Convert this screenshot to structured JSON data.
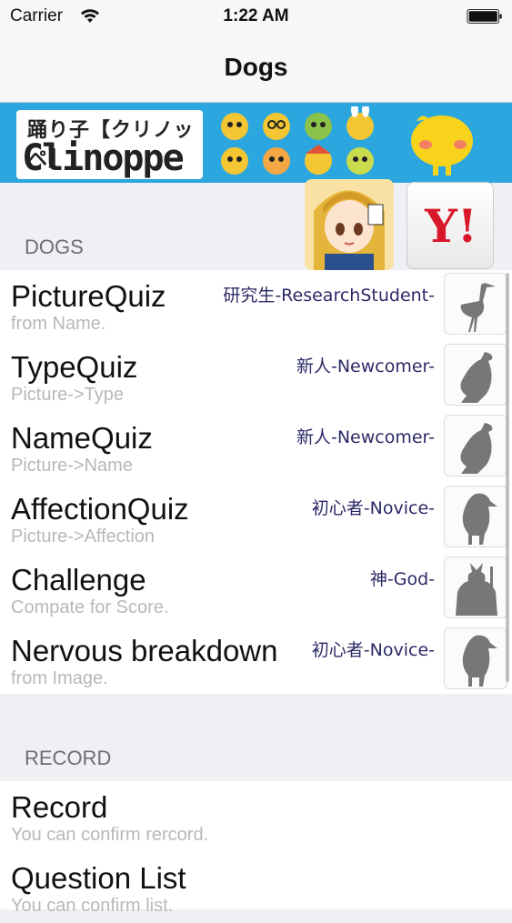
{
  "status": {
    "carrier": "Carrier",
    "time": "1:22 AM"
  },
  "nav": {
    "title": "Dogs"
  },
  "banner": {
    "logo_top": "踊り子【クリノッペ】",
    "logo_main": "Clinoppe"
  },
  "ads": {
    "yahoo_label": "Y!"
  },
  "sections": [
    {
      "header": "DOGS",
      "rows": [
        {
          "title": "PictureQuiz",
          "subtitle": "from Name.",
          "rank": "研究生-ResearchStudent-",
          "icon": "crane-silhouette-icon"
        },
        {
          "title": "TypeQuiz",
          "subtitle": "Picture->Type",
          "rank": "新人-Newcomer-",
          "icon": "eagle-silhouette-icon"
        },
        {
          "title": "NameQuiz",
          "subtitle": "Picture->Name",
          "rank": "新人-Newcomer-",
          "icon": "eagle-silhouette-icon"
        },
        {
          "title": "AffectionQuiz",
          "subtitle": "Picture->Affection",
          "rank": "初心者-Novice-",
          "icon": "puffin-silhouette-icon"
        },
        {
          "title": "Challenge",
          "subtitle": "Compate for Score.",
          "rank": "神-God-",
          "icon": "samurai-silhouette-icon"
        },
        {
          "title": "Nervous breakdown",
          "subtitle": "from Image.",
          "rank": "初心者-Novice-",
          "icon": "puffin-silhouette-icon"
        }
      ]
    },
    {
      "header": "RECORD",
      "rows": [
        {
          "title": "Record",
          "subtitle": "You can confirm rercord."
        },
        {
          "title": "Question List",
          "subtitle": "You can confirm list."
        }
      ]
    }
  ],
  "colors": {
    "banner": "#2ba6de",
    "rank_text": "#2c2a66",
    "subtitle": "#b8b8bc",
    "background": "#efeff4"
  }
}
